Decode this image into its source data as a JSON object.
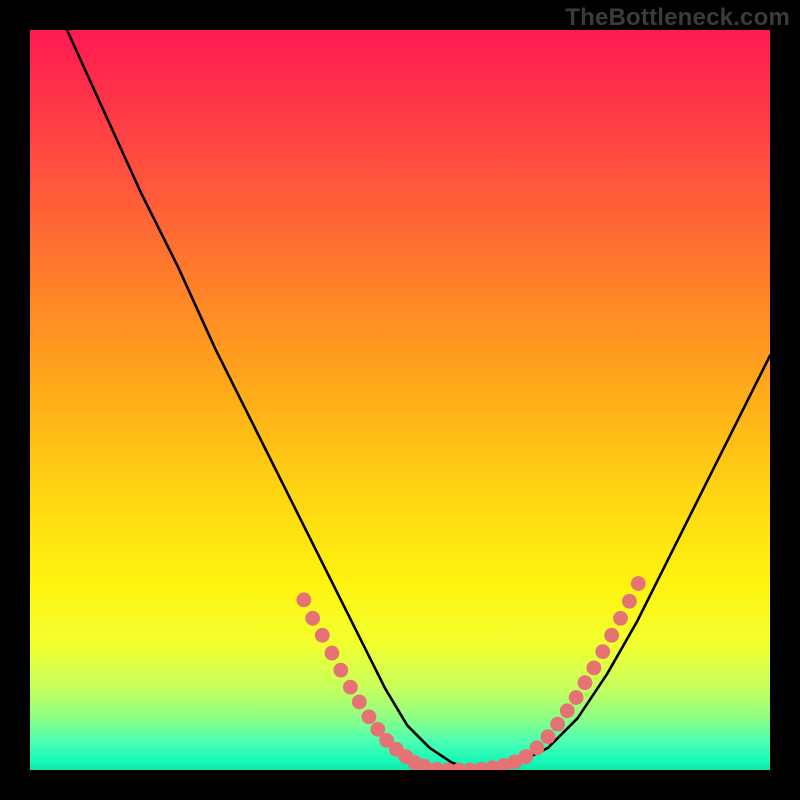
{
  "watermark": "TheBottleneck.com",
  "chart_data": {
    "type": "line",
    "title": "",
    "xlabel": "",
    "ylabel": "",
    "xlim": [
      0,
      100
    ],
    "ylim": [
      0,
      100
    ],
    "grid": false,
    "series": [
      {
        "name": "curve",
        "color": "#000000",
        "x": [
          5,
          10,
          15,
          20,
          25,
          30,
          35,
          40,
          45,
          48,
          51,
          54,
          57,
          60,
          63,
          66,
          70,
          74,
          78,
          82,
          86,
          90,
          94,
          98,
          100
        ],
        "y": [
          100,
          89,
          78,
          68,
          57,
          47,
          37,
          27,
          17,
          11,
          6,
          3,
          1,
          0,
          0,
          1,
          3,
          7,
          13,
          20,
          28,
          36,
          44,
          52,
          56
        ]
      },
      {
        "name": "dots-left",
        "color": "#e57373",
        "x": [
          37,
          38.2,
          39.5,
          40.8,
          42,
          43.3,
          44.5,
          45.8,
          47,
          48.2,
          49.5,
          50.8,
          52,
          53.3
        ],
        "y": [
          23,
          20.5,
          18.2,
          15.8,
          13.5,
          11.2,
          9.2,
          7.2,
          5.5,
          4,
          2.8,
          1.8,
          1,
          0.5
        ]
      },
      {
        "name": "dots-bottom",
        "color": "#e57373",
        "x": [
          55,
          56.5,
          58,
          59.5,
          61,
          62.5,
          64,
          65.5,
          67
        ],
        "y": [
          0.1,
          0,
          0,
          0,
          0.1,
          0.3,
          0.6,
          1.1,
          1.8
        ]
      },
      {
        "name": "dots-right",
        "color": "#e57373",
        "x": [
          68.5,
          70,
          71.3,
          72.6,
          73.8,
          75,
          76.2,
          77.4,
          78.6,
          79.8,
          81,
          82.2
        ],
        "y": [
          3,
          4.5,
          6.2,
          8,
          9.8,
          11.8,
          13.8,
          16,
          18.2,
          20.5,
          22.8,
          25.2
        ]
      }
    ],
    "background_gradient": {
      "direction": "vertical",
      "stops": [
        {
          "pos": 0.0,
          "color": "#ff1a52"
        },
        {
          "pos": 0.5,
          "color": "#ffae18"
        },
        {
          "pos": 0.8,
          "color": "#fff410"
        },
        {
          "pos": 0.93,
          "color": "#8cff86"
        },
        {
          "pos": 1.0,
          "color": "#10e6a8"
        }
      ]
    }
  }
}
